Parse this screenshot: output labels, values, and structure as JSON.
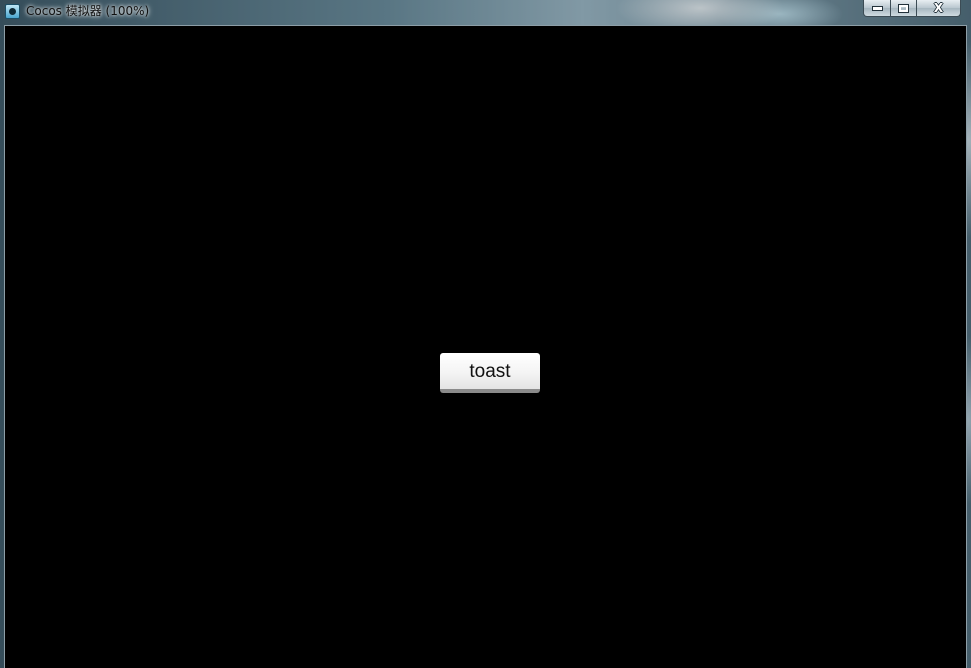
{
  "window": {
    "title": "Cocos 模拟器 (100%)",
    "icon": "cocos-app-icon",
    "controls": {
      "minimize": "minimize-icon",
      "maximize": "maximize-icon",
      "close_glyph": "X"
    }
  },
  "scene": {
    "background_color": "#000000",
    "button": {
      "label": "toast"
    }
  }
}
